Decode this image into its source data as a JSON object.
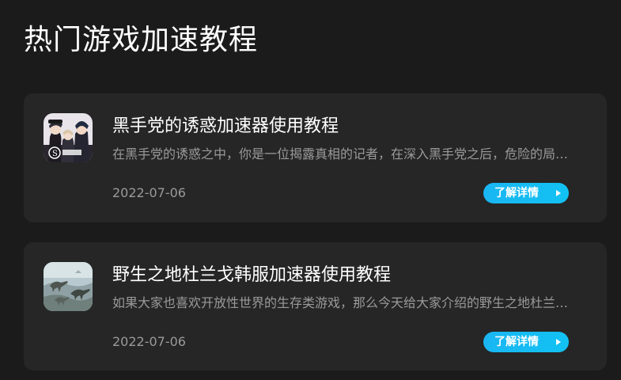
{
  "page": {
    "title": "热门游戏加速教程"
  },
  "tutorials": [
    {
      "title": "黑手党的诱惑加速器使用教程",
      "description": "在黑手党的诱惑之中，你是一位揭露真相的记者，在深入黑手党之后，危险的局势悄然展开……",
      "date": "2022-07-06",
      "button_label": "了解详情",
      "thumbnail_icon": "anime-characters-game-icon"
    },
    {
      "title": "野生之地杜兰戈韩服加速器使用教程",
      "description": "如果大家也喜欢开放性世界的生存类游戏，那么今天给大家介绍的野生之地杜兰戈一定不要错过……",
      "date": "2022-07-06",
      "button_label": "了解详情",
      "thumbnail_icon": "dinosaur-game-icon"
    }
  ],
  "colors": {
    "background": "#1b1b1b",
    "card": "#262626",
    "accent": "#12c2f3",
    "muted_text": "#9a9a9a"
  }
}
